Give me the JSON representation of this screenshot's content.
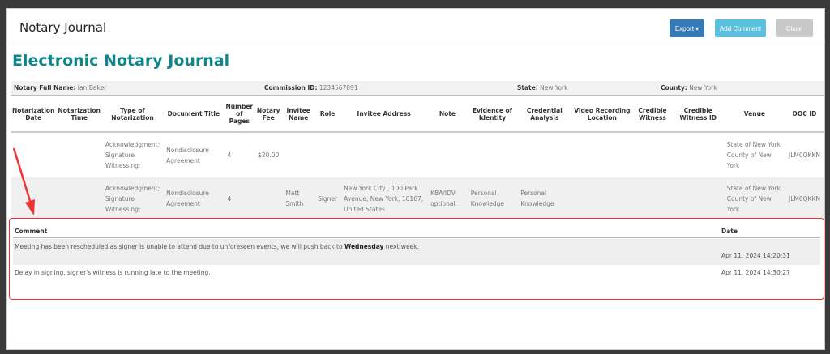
{
  "modal": {
    "title": "Notary Journal",
    "export_label": "Export",
    "add_comment_label": "Add Comment",
    "close_label": "Close"
  },
  "heading": "Electronic Notary Journal",
  "info": {
    "name_label": "Notary Full Name:",
    "name": "Ian Baker",
    "commission_label": "Commission ID:",
    "commission": "1234567891",
    "state_label": "State:",
    "state": "New York",
    "county_label": "County:",
    "county": "New York"
  },
  "columns": [
    "Notarization Date",
    "Notarization Time",
    "Type of Notarization",
    "Document Title",
    "Number of Pages",
    "Notary Fee",
    "Invitee Name",
    "Role",
    "Invitee Address",
    "Note",
    "Evidence of Identity",
    "Credential Analysis",
    "Video Recording Location",
    "Credible Witness",
    "Credible Witness ID",
    "Venue",
    "DOC ID"
  ],
  "rows": [
    [
      "",
      "",
      "Acknowledgment; Signature Witnessing;",
      "Nondisclosure Agreement",
      "4",
      "$20.00",
      "",
      "",
      "",
      "",
      "",
      "",
      "",
      "",
      "",
      "State of New York County of New York",
      "JLM0QKKN"
    ],
    [
      "",
      "",
      "Acknowledgment; Signature Witnessing;",
      "Nondisclosure Agreement",
      "4",
      "",
      "Matt  Smith",
      "Signer",
      "New York City , 100 Park Avenue, New York, 10167, United States",
      "KBA/IDV optional.",
      "Personal Knowledge",
      "Personal Knowledge",
      "",
      "",
      "",
      "State of New York County of New York",
      "JLM0QKKN"
    ]
  ],
  "comments": {
    "comment_header": "Comment",
    "date_header": "Date",
    "items": [
      {
        "pre": "Meeting has been rescheduled as signer is unable to attend due to unforeseen events, we will push back to ",
        "bold": "Wednesday",
        "post": " next week.",
        "date": "Apr 11, 2024 14:20:31"
      },
      {
        "pre": "Delay in signing, signer's witness is running late to the meeting.",
        "bold": "",
        "post": "",
        "date": "Apr 11, 2024 14:30:27"
      }
    ]
  },
  "colors": {
    "accent": "#11868a",
    "annotation": "#e33333"
  }
}
